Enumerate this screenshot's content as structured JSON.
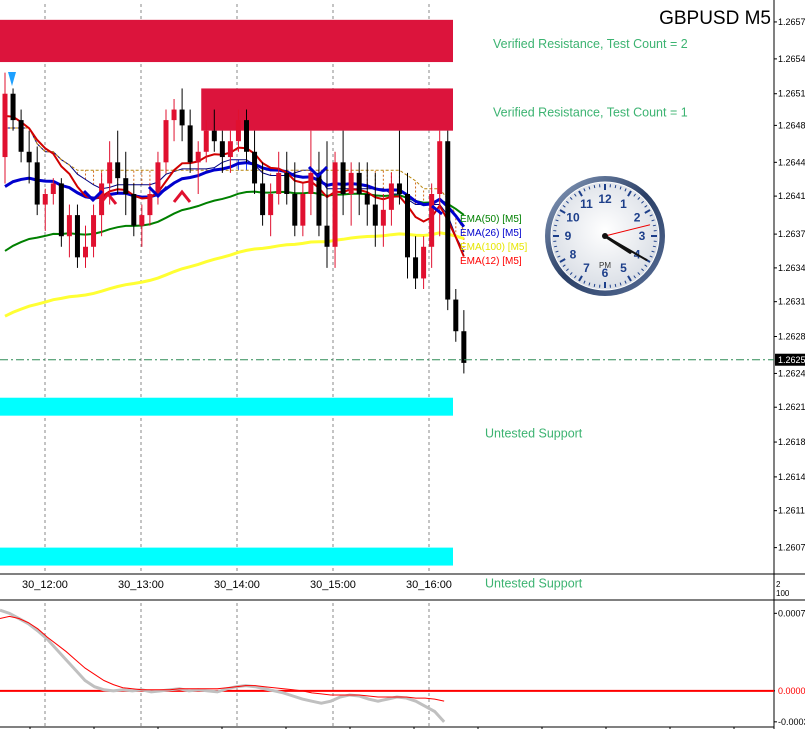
{
  "chart_data": [
    {
      "type": "candlestick",
      "title": "GBPUSD M5",
      "x_ticks": [
        "30_12:00",
        "30_13:00",
        "30_14:00",
        "30_15:00",
        "30_16:00"
      ],
      "y_ticks": [
        "1.2657",
        "1.2654",
        "1.2651",
        "1.2648",
        "1.2644",
        "1.2641",
        "1.2637",
        "1.2634",
        "1.2631",
        "1.2628",
        "1.2624",
        "1.2621",
        "1.2618",
        "1.2614",
        "1.2611",
        "1.2607"
      ],
      "ylim": [
        1.2605,
        1.2659
      ],
      "current_price": "1.2625",
      "current_price_value": 1.26253,
      "zones": [
        {
          "label": "Verified Resistance, Test Count = 2",
          "low": 1.26535,
          "high": 1.26575,
          "color": "#dc143c",
          "start": 0
        },
        {
          "label": "Verified Resistance, Test Count = 1",
          "low": 1.2647,
          "high": 1.2651,
          "color": "#dc143c",
          "start": 25
        },
        {
          "label": "Untested Support",
          "low": 1.262,
          "high": 1.26217,
          "color": "#00ffff",
          "start": 0
        },
        {
          "label": "Untested Support",
          "low": 1.26058,
          "high": 1.26075,
          "color": "#00ffff",
          "start": 0
        }
      ],
      "ema_legend": [
        {
          "label": "EMA(50) [M5]",
          "color": "#008000"
        },
        {
          "label": "EMA(26) [M5]",
          "color": "#0000cd"
        },
        {
          "label": "EMA(100) [M5]",
          "color": "#e6e600"
        },
        {
          "label": "EMA(12) [M5]",
          "color": "#ff0000"
        }
      ],
      "candles": [
        {
          "o": 1.26445,
          "h": 1.26525,
          "l": 1.2642,
          "c": 1.26505
        },
        {
          "o": 1.26505,
          "h": 1.2651,
          "l": 1.2647,
          "c": 1.2648
        },
        {
          "o": 1.2648,
          "h": 1.2649,
          "l": 1.2644,
          "c": 1.2645
        },
        {
          "o": 1.2645,
          "h": 1.2647,
          "l": 1.2642,
          "c": 1.2644
        },
        {
          "o": 1.2644,
          "h": 1.26455,
          "l": 1.2639,
          "c": 1.264
        },
        {
          "o": 1.264,
          "h": 1.26415,
          "l": 1.26375,
          "c": 1.2641
        },
        {
          "o": 1.2641,
          "h": 1.26425,
          "l": 1.264,
          "c": 1.2642
        },
        {
          "o": 1.2642,
          "h": 1.26425,
          "l": 1.2636,
          "c": 1.2637
        },
        {
          "o": 1.2637,
          "h": 1.264,
          "l": 1.2635,
          "c": 1.2639
        },
        {
          "o": 1.2639,
          "h": 1.264,
          "l": 1.2634,
          "c": 1.2635
        },
        {
          "o": 1.2635,
          "h": 1.2638,
          "l": 1.2634,
          "c": 1.2636
        },
        {
          "o": 1.2636,
          "h": 1.264,
          "l": 1.2635,
          "c": 1.2639
        },
        {
          "o": 1.2639,
          "h": 1.2643,
          "l": 1.2637,
          "c": 1.2642
        },
        {
          "o": 1.2642,
          "h": 1.2646,
          "l": 1.264,
          "c": 1.2644
        },
        {
          "o": 1.2644,
          "h": 1.2647,
          "l": 1.2641,
          "c": 1.26425
        },
        {
          "o": 1.26425,
          "h": 1.2645,
          "l": 1.2639,
          "c": 1.2641
        },
        {
          "o": 1.2641,
          "h": 1.2642,
          "l": 1.2637,
          "c": 1.2638
        },
        {
          "o": 1.2638,
          "h": 1.264,
          "l": 1.2636,
          "c": 1.2639
        },
        {
          "o": 1.2639,
          "h": 1.2642,
          "l": 1.2638,
          "c": 1.2641
        },
        {
          "o": 1.2641,
          "h": 1.2645,
          "l": 1.264,
          "c": 1.2644
        },
        {
          "o": 1.2644,
          "h": 1.2649,
          "l": 1.2643,
          "c": 1.2648
        },
        {
          "o": 1.2648,
          "h": 1.265,
          "l": 1.2646,
          "c": 1.2649
        },
        {
          "o": 1.2649,
          "h": 1.2651,
          "l": 1.2646,
          "c": 1.26475
        },
        {
          "o": 1.26475,
          "h": 1.2649,
          "l": 1.2643,
          "c": 1.2644
        },
        {
          "o": 1.2644,
          "h": 1.2646,
          "l": 1.2641,
          "c": 1.2645
        },
        {
          "o": 1.2645,
          "h": 1.2648,
          "l": 1.2644,
          "c": 1.2647
        },
        {
          "o": 1.2647,
          "h": 1.2649,
          "l": 1.2645,
          "c": 1.2646
        },
        {
          "o": 1.2646,
          "h": 1.2647,
          "l": 1.2643,
          "c": 1.26445
        },
        {
          "o": 1.26445,
          "h": 1.2647,
          "l": 1.2643,
          "c": 1.2646
        },
        {
          "o": 1.2646,
          "h": 1.2649,
          "l": 1.2645,
          "c": 1.2648
        },
        {
          "o": 1.2648,
          "h": 1.2649,
          "l": 1.2644,
          "c": 1.2645
        },
        {
          "o": 1.2645,
          "h": 1.2647,
          "l": 1.2641,
          "c": 1.2642
        },
        {
          "o": 1.2642,
          "h": 1.2644,
          "l": 1.2638,
          "c": 1.2639
        },
        {
          "o": 1.2639,
          "h": 1.2642,
          "l": 1.2637,
          "c": 1.2641
        },
        {
          "o": 1.2641,
          "h": 1.2645,
          "l": 1.264,
          "c": 1.2643
        },
        {
          "o": 1.2643,
          "h": 1.2645,
          "l": 1.264,
          "c": 1.2641
        },
        {
          "o": 1.2641,
          "h": 1.2644,
          "l": 1.2637,
          "c": 1.2638
        },
        {
          "o": 1.2638,
          "h": 1.2642,
          "l": 1.2637,
          "c": 1.2641
        },
        {
          "o": 1.2641,
          "h": 1.2647,
          "l": 1.2639,
          "c": 1.2643
        },
        {
          "o": 1.2643,
          "h": 1.2645,
          "l": 1.2637,
          "c": 1.2638
        },
        {
          "o": 1.2638,
          "h": 1.2646,
          "l": 1.2634,
          "c": 1.2636
        },
        {
          "o": 1.2636,
          "h": 1.2645,
          "l": 1.2634,
          "c": 1.2644
        },
        {
          "o": 1.2644,
          "h": 1.2647,
          "l": 1.2639,
          "c": 1.2641
        },
        {
          "o": 1.2641,
          "h": 1.2644,
          "l": 1.2638,
          "c": 1.2643
        },
        {
          "o": 1.2643,
          "h": 1.2644,
          "l": 1.2639,
          "c": 1.2641
        },
        {
          "o": 1.2641,
          "h": 1.2644,
          "l": 1.2638,
          "c": 1.264
        },
        {
          "o": 1.264,
          "h": 1.2643,
          "l": 1.2636,
          "c": 1.2638
        },
        {
          "o": 1.2638,
          "h": 1.2641,
          "l": 1.2636,
          "c": 1.26395
        },
        {
          "o": 1.26395,
          "h": 1.2643,
          "l": 1.2638,
          "c": 1.2642
        },
        {
          "o": 1.2642,
          "h": 1.2647,
          "l": 1.264,
          "c": 1.2641
        },
        {
          "o": 1.2641,
          "h": 1.2643,
          "l": 1.2633,
          "c": 1.2635
        },
        {
          "o": 1.2635,
          "h": 1.2637,
          "l": 1.2632,
          "c": 1.2633
        },
        {
          "o": 1.2633,
          "h": 1.2637,
          "l": 1.2632,
          "c": 1.2636
        },
        {
          "o": 1.2636,
          "h": 1.2642,
          "l": 1.2634,
          "c": 1.2641
        },
        {
          "o": 1.2641,
          "h": 1.2647,
          "l": 1.2637,
          "c": 1.2646
        },
        {
          "o": 1.2646,
          "h": 1.2647,
          "l": 1.263,
          "c": 1.2631
        },
        {
          "o": 1.2631,
          "h": 1.2632,
          "l": 1.2627,
          "c": 1.2628
        },
        {
          "o": 1.2628,
          "h": 1.263,
          "l": 1.2624,
          "c": 1.2625
        }
      ]
    },
    {
      "type": "line",
      "y_ticks": [
        "0.0007",
        "0.0000",
        "-0.0003"
      ],
      "ylim": [
        -0.00035,
        0.00085
      ],
      "zero_line_color": "#ff0000",
      "series": [
        {
          "color": "#c0c0c0",
          "values": [
            0.00078,
            0.00075,
            0.0007,
            0.00065,
            0.00058,
            0.0005,
            0.0004,
            0.0003,
            0.0002,
            0.0001,
            4e-05,
            1e-05,
            0.0,
            1e-05,
            0.0,
            1e-05,
            -1e-05,
            0.0,
            1e-05,
            2e-05,
            0.0,
            1e-05,
            0.0,
            -1e-05,
            2e-05,
            4e-05,
            5e-05,
            4e-05,
            2e-05,
            0.0,
            -2e-05,
            -5e-05,
            -8e-05,
            -0.0001,
            -0.00012,
            -0.0001,
            -6e-05,
            -4e-05,
            -5e-05,
            -8e-05,
            -0.0001,
            -8e-05,
            -6e-05,
            -7e-05,
            -0.0001,
            -0.00015,
            -0.0002,
            -0.0003
          ]
        },
        {
          "color": "#ff0000",
          "values": [
            0.0007,
            0.00072,
            0.0007,
            0.00066,
            0.0006,
            0.00052,
            0.00045,
            0.00038,
            0.0003,
            0.00022,
            0.00016,
            0.0001,
            6e-05,
            3e-05,
            2e-05,
            1e-05,
            1e-05,
            1e-05,
            1e-05,
            2e-05,
            2e-05,
            2e-05,
            2e-05,
            2e-05,
            3e-05,
            4e-05,
            5e-05,
            5e-05,
            4e-05,
            3e-05,
            2e-05,
            1e-05,
            0.0,
            -2e-05,
            -3e-05,
            -4e-05,
            -4e-05,
            -4e-05,
            -4e-05,
            -5e-05,
            -6e-05,
            -6e-05,
            -6e-05,
            -6e-05,
            -7e-05,
            -7e-05,
            -8e-05,
            -0.0001
          ]
        }
      ]
    }
  ],
  "clock": {
    "am_pm": "PM",
    "numbers": [
      "12",
      "1",
      "2",
      "3",
      "4",
      "5",
      "6",
      "7",
      "8",
      "9",
      "10",
      "11"
    ]
  },
  "right_axis_labels": {
    "sub_top": "2",
    "sub_bottom": "100"
  }
}
